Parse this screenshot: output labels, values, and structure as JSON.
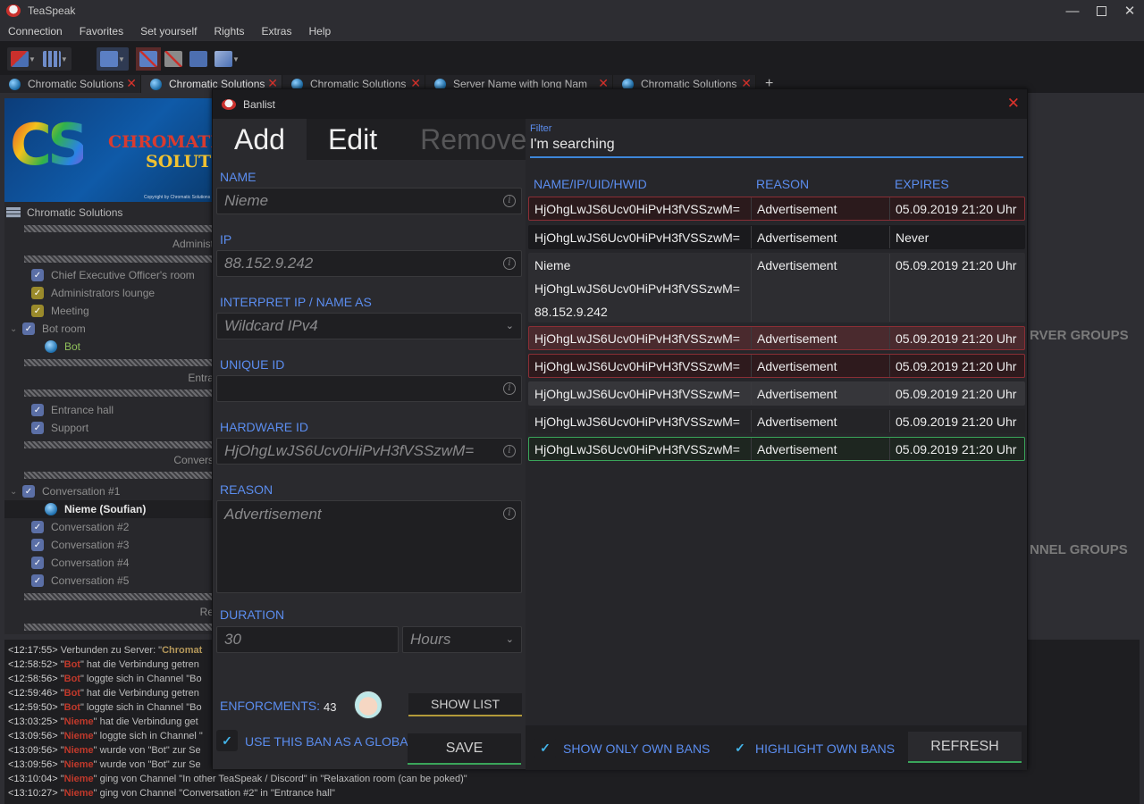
{
  "app": {
    "title": "TeaSpeak",
    "window_controls": {
      "minimize": "—",
      "maximize": "",
      "close": "✕"
    }
  },
  "menu": [
    "Connection",
    "Favorites",
    "Set yourself",
    "Rights",
    "Extras",
    "Help"
  ],
  "tabs": [
    {
      "label": "Chromatic Solutions",
      "active": false
    },
    {
      "label": "Chromatic Solutions",
      "active": true
    },
    {
      "label": "Chromatic Solutions",
      "active": false
    },
    {
      "label": "Server Name with long Name",
      "active": false
    },
    {
      "label": "Chromatic Solutions",
      "active": false
    }
  ],
  "tab_add": "+",
  "tree": {
    "banner": {
      "line1": "CHROMATIC",
      "line2": "SOLUTIONS",
      "copyright": "Copyright by Chromatic Solutions"
    },
    "server": "Chromatic Solutions",
    "spacer_admin": "Administ",
    "spacer_entrance": "Entra",
    "spacer_conv": "Convers",
    "spacer_re": "Re",
    "channels_admin": [
      "Chief Executive Officer's room",
      "Administrators lounge",
      "Meeting",
      "Bot room"
    ],
    "bot_client": "Bot",
    "channels_entrance": [
      "Entrance hall",
      "Support"
    ],
    "conv_first": "Conversation #1",
    "conv_client": "Nieme (Soufian)",
    "channels_conv": [
      "Conversation #2",
      "Conversation #3",
      "Conversation #4",
      "Conversation #5"
    ]
  },
  "background_panels": {
    "server_groups": "RVER GROUPS",
    "channel_groups": "NNEL GROUPS"
  },
  "log": [
    {
      "ts": "<12:17:55>",
      "rest": " Verbunden zu Server: \"",
      "hl": "Chromat",
      "hl_class": "gold",
      "tail": ""
    },
    {
      "ts": "<12:58:52>",
      "rest": " \"",
      "hl": "Bot",
      "hl_class": "red",
      "tail": "\" hat die Verbindung getren"
    },
    {
      "ts": "<12:58:56>",
      "rest": " \"",
      "hl": "Bot",
      "hl_class": "red",
      "tail": "\" loggte sich in Channel \"Bo"
    },
    {
      "ts": "<12:59:46>",
      "rest": " \"",
      "hl": "Bot",
      "hl_class": "red",
      "tail": "\" hat die Verbindung getren"
    },
    {
      "ts": "<12:59:50>",
      "rest": " \"",
      "hl": "Bot",
      "hl_class": "red",
      "tail": "\" loggte sich in Channel \"Bo"
    },
    {
      "ts": "<13:03:25>",
      "rest": " \"",
      "hl": "Nieme",
      "hl_class": "red",
      "tail": "\" hat die Verbindung get"
    },
    {
      "ts": "<13:09:56>",
      "rest": " \"",
      "hl": "Nieme",
      "hl_class": "red",
      "tail": "\" loggte sich in Channel \""
    },
    {
      "ts": "<13:09:56>",
      "rest": " \"",
      "hl": "Nieme",
      "hl_class": "red",
      "tail": "\" wurde von \"Bot\" zur Se"
    },
    {
      "ts": "<13:09:56>",
      "rest": " \"",
      "hl": "Nieme",
      "hl_class": "red",
      "tail": "\" wurde von \"Bot\" zur Se"
    },
    {
      "ts": "<13:10:04>",
      "rest": " \"",
      "hl": "Nieme",
      "hl_class": "red",
      "tail": "\" ging von Channel \"In other TeaSpeak / Discord\" in \"Relaxation room (can be poked)\""
    },
    {
      "ts": "<13:10:27>",
      "rest": " \"",
      "hl": "Nieme",
      "hl_class": "red",
      "tail": "\" ging von Channel \"Conversation #2\" in \"Entrance hall\""
    }
  ],
  "dialog": {
    "title": "Banlist",
    "close": "✕",
    "mode_tabs": {
      "add": "Add",
      "edit": "Edit",
      "remove": "Remove"
    },
    "form": {
      "name_label": "NAME",
      "name_placeholder": "Nieme",
      "ip_label": "IP",
      "ip_placeholder": "88.152.9.242",
      "interpret_label": "INTERPRET IP / NAME AS",
      "interpret_value": "Wildcard IPv4",
      "uid_label": "UNIQUE ID",
      "uid_placeholder": "",
      "hwid_label": "HARDWARE ID",
      "hwid_placeholder": "HjOhgLwJS6Ucv0HiPvH3fVSSzwM=",
      "reason_label": "REASON",
      "reason_placeholder": "Advertisement",
      "duration_label": "DURATION",
      "duration_value": "30",
      "duration_unit": "Hours",
      "enforcements_label": "ENFORCMENTS:",
      "enforcements_count": "43",
      "show_list": "SHOW LIST",
      "global_ban": "USE THIS BAN AS A GLOBAL BAN",
      "save": "SAVE"
    },
    "filter": {
      "label": "Filter",
      "value": "I'm searching"
    },
    "columns": {
      "name": "NAME/IP/UID/HWID",
      "reason": "REASON",
      "expires": "EXPIRES"
    },
    "rows": [
      {
        "name": "HjOhgLwJS6Ucv0HiPvH3fVSSzwM=",
        "reason": "Advertisement",
        "expires": "05.09.2019 21:20 Uhr",
        "style": "dark-red"
      },
      {
        "name": "HjOhgLwJS6Ucv0HiPvH3fVSSzwM=",
        "reason": "Advertisement",
        "expires": "Never",
        "style": "black"
      },
      {
        "name": "Nieme",
        "name2": "HjOhgLwJS6Ucv0HiPvH3fVSSzwM=",
        "name3": "88.152.9.242",
        "reason": "Advertisement",
        "expires": "05.09.2019 21:20 Uhr",
        "style": "grey-multi"
      },
      {
        "name": "HjOhgLwJS6Ucv0HiPvH3fVSSzwM=",
        "reason": "Advertisement",
        "expires": "05.09.2019 21:20 Uhr",
        "style": "red"
      },
      {
        "name": "HjOhgLwJS6Ucv0HiPvH3fVSSzwM=",
        "reason": "Advertisement",
        "expires": "05.09.2019 21:20 Uhr",
        "style": "dark-red"
      },
      {
        "name": "HjOhgLwJS6Ucv0HiPvH3fVSSzwM=",
        "reason": "Advertisement",
        "expires": "05.09.2019 21:20 Uhr",
        "style": "grey"
      },
      {
        "name": "HjOhgLwJS6Ucv0HiPvH3fVSSzwM=",
        "reason": "Advertisement",
        "expires": "05.09.2019 21:20 Uhr",
        "style": "dark"
      },
      {
        "name": "HjOhgLwJS6Ucv0HiPvH3fVSSzwM=",
        "reason": "Advertisement",
        "expires": "05.09.2019 21:20 Uhr",
        "style": "green"
      }
    ],
    "footer": {
      "show_own": "SHOW ONLY OWN BANS",
      "highlight_own": "HIGHLIGHT OWN BANS",
      "refresh": "REFRESH"
    },
    "colors": {
      "accent_blue": "#5b8def",
      "save_underline": "#3aa55a",
      "show_list_underline": "#b39a3a",
      "filter_underline": "#3d86d9"
    }
  }
}
